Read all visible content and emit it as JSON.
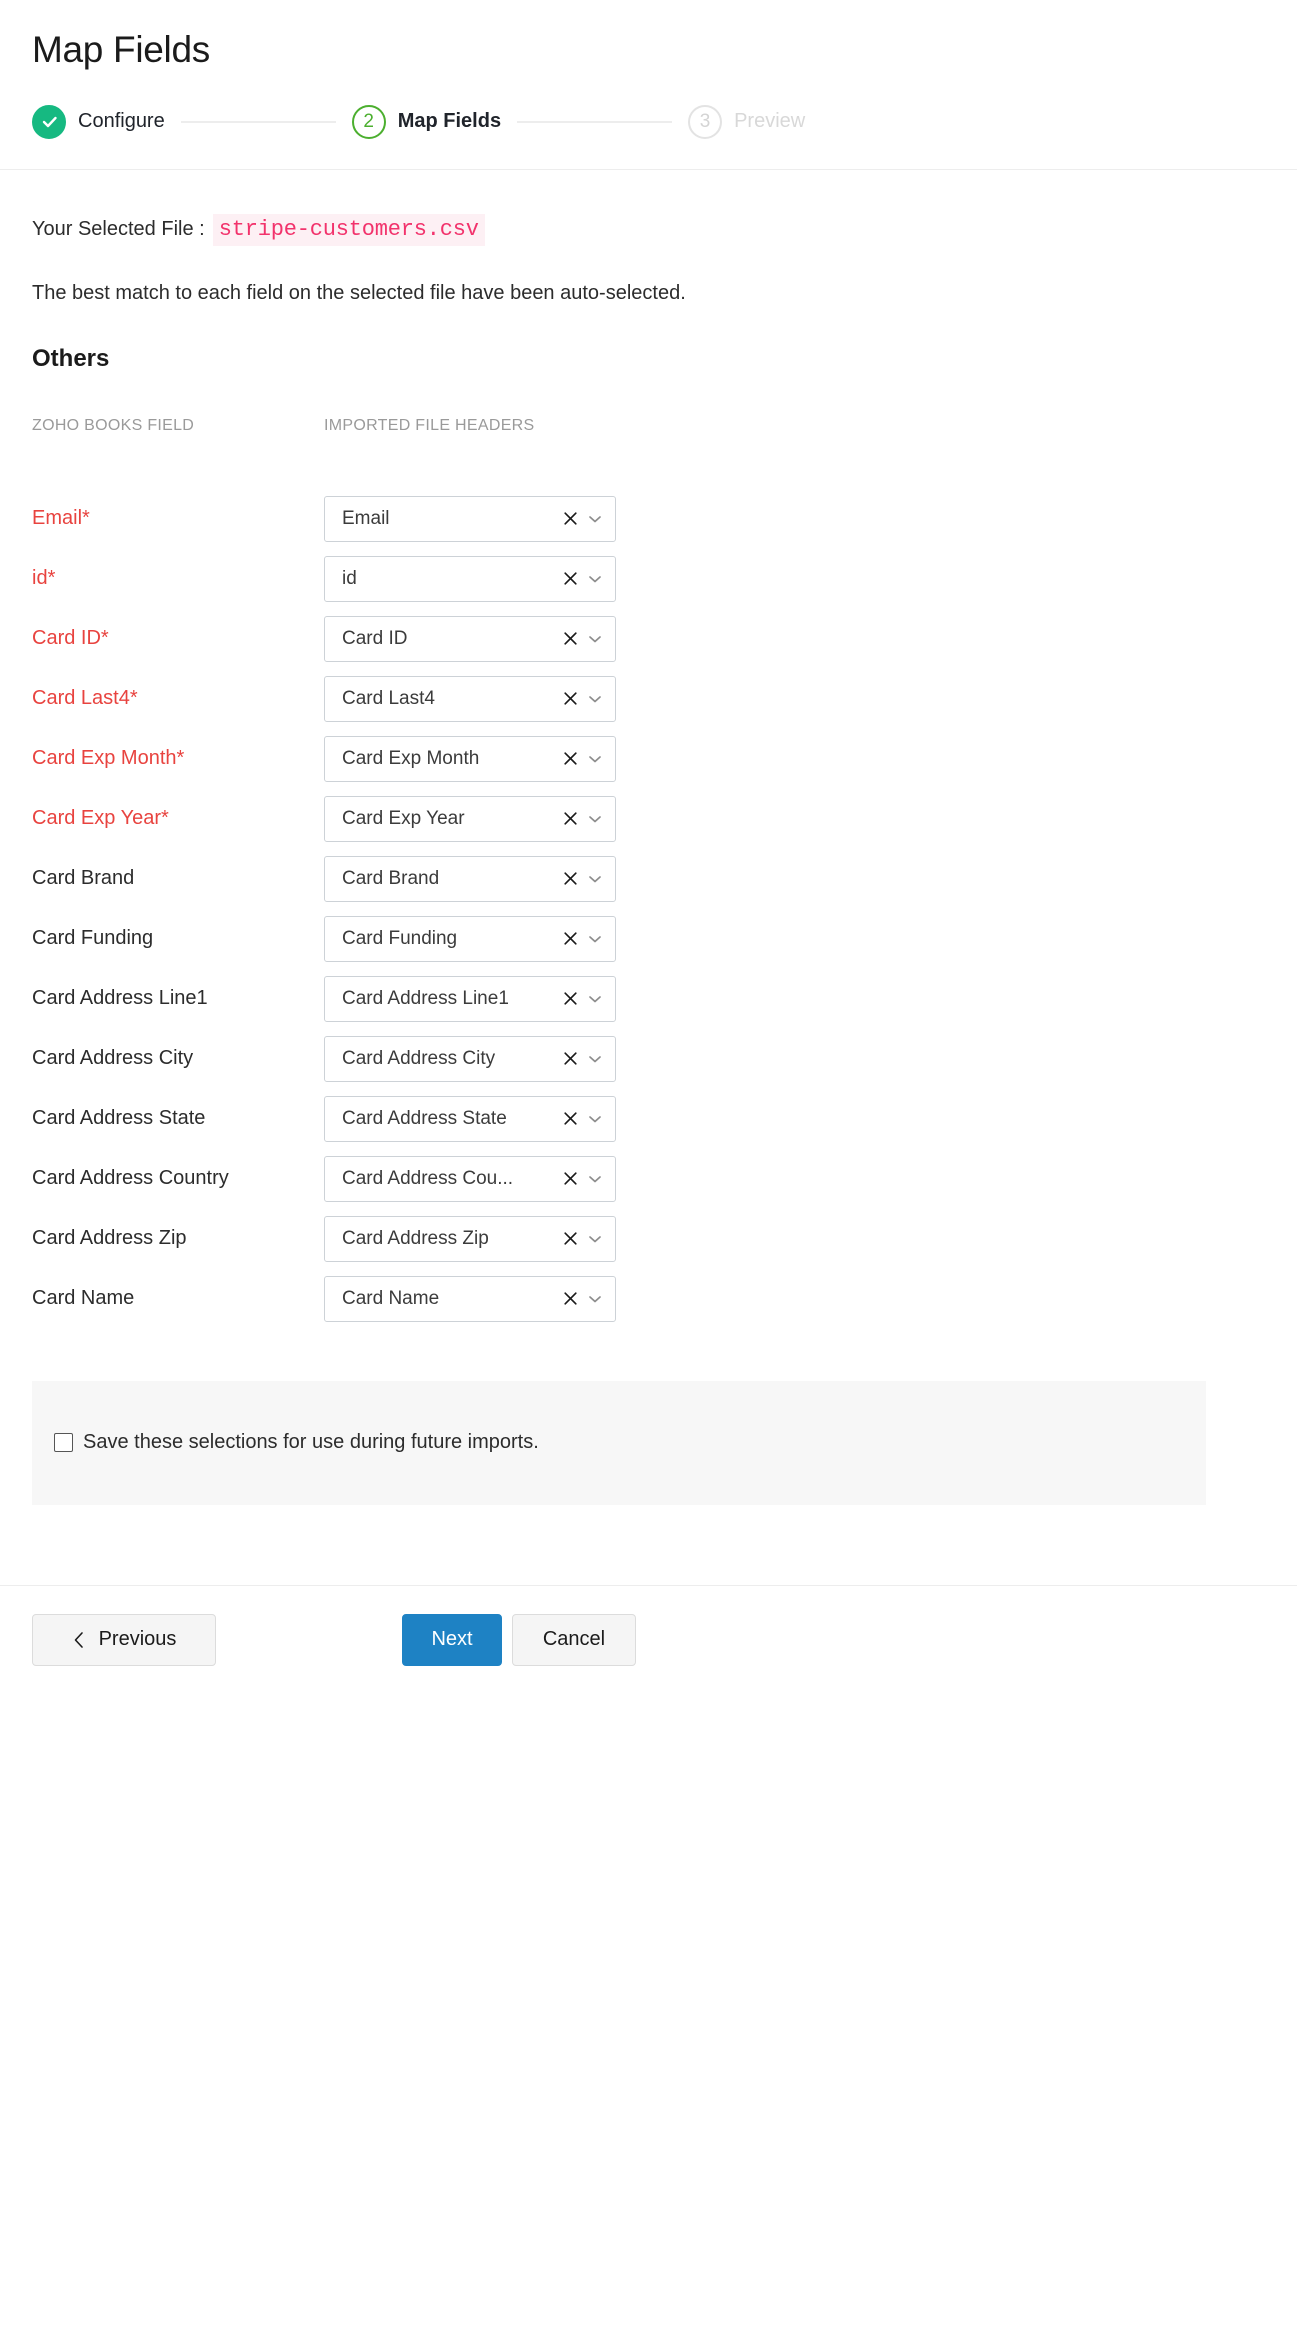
{
  "header": {
    "title": "Map Fields"
  },
  "stepper": {
    "steps": [
      {
        "number": "1",
        "label": "Configure",
        "state": "done",
        "icon": "check-icon"
      },
      {
        "number": "2",
        "label": "Map Fields",
        "state": "current"
      },
      {
        "number": "3",
        "label": "Preview",
        "state": "upcoming"
      }
    ],
    "colors": {
      "done": "#16b981",
      "current": "#4caf2f",
      "upcoming": "#e3e3e3"
    }
  },
  "file_info": {
    "label": "Your Selected File :",
    "filename": "stripe-customers.csv",
    "filename_color": "#f2336c",
    "filename_bg": "#fdf0f4"
  },
  "hint": "The best match to each field on the selected file have been auto-selected.",
  "group": {
    "title": "Others"
  },
  "columns": {
    "left_header": "ZOHO BOOKS FIELD",
    "right_header": "IMPORTED FILE HEADERS"
  },
  "required_color": "#e8433f",
  "mappings": [
    {
      "field": "Email*",
      "required": true,
      "value": "Email"
    },
    {
      "field": "id*",
      "required": true,
      "value": "id"
    },
    {
      "field": "Card ID*",
      "required": true,
      "value": "Card ID"
    },
    {
      "field": "Card Last4*",
      "required": true,
      "value": "Card Last4"
    },
    {
      "field": "Card Exp Month*",
      "required": true,
      "value": "Card Exp Month"
    },
    {
      "field": "Card Exp Year*",
      "required": true,
      "value": "Card Exp Year"
    },
    {
      "field": "Card Brand",
      "required": false,
      "value": "Card Brand"
    },
    {
      "field": "Card Funding",
      "required": false,
      "value": "Card Funding"
    },
    {
      "field": "Card Address Line1",
      "required": false,
      "value": "Card Address Line1"
    },
    {
      "field": "Card Address City",
      "required": false,
      "value": "Card Address City"
    },
    {
      "field": "Card Address State",
      "required": false,
      "value": "Card Address State"
    },
    {
      "field": "Card Address Country",
      "required": false,
      "value": "Card Address Cou..."
    },
    {
      "field": "Card Address Zip",
      "required": false,
      "value": "Card Address Zip"
    },
    {
      "field": "Card Name",
      "required": false,
      "value": "Card Name"
    }
  ],
  "select_icons": {
    "clear": "close-icon",
    "expand": "chevron-down-icon"
  },
  "save_selections": {
    "label": "Save these selections for use during future imports.",
    "checked": false
  },
  "footer": {
    "previous_label": "Previous",
    "previous_icon": "chevron-left-icon",
    "next_label": "Next",
    "cancel_label": "Cancel",
    "next_color": "#1e82c4"
  }
}
